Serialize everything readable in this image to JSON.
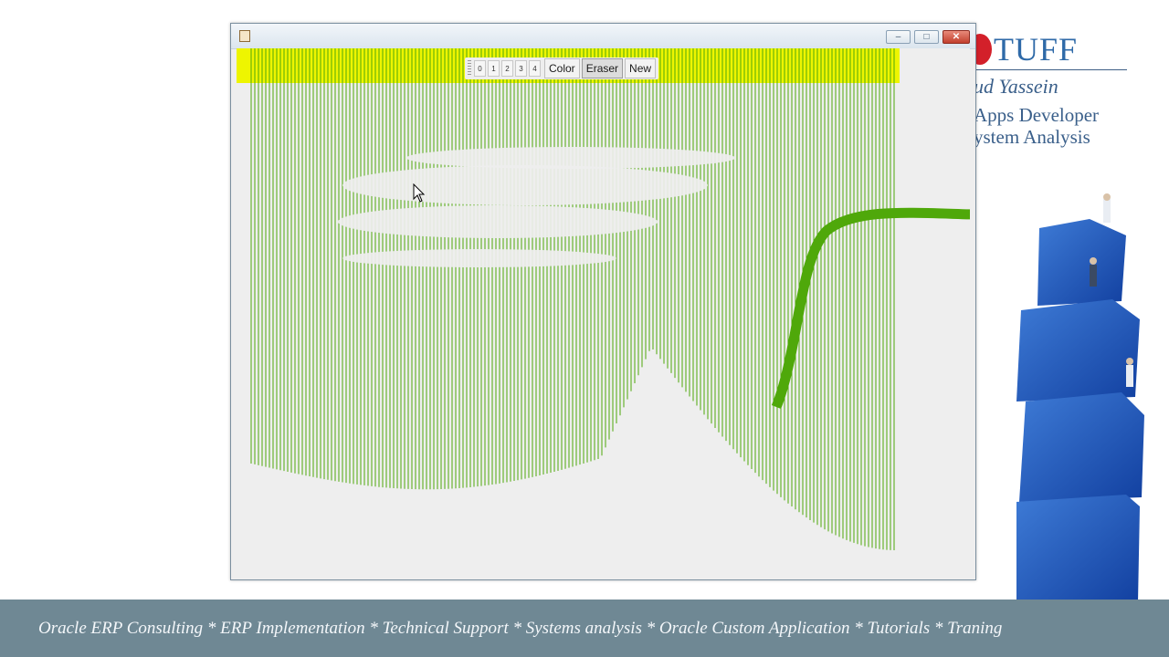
{
  "slide": {
    "brand_logo_text": "TUFF",
    "brand_name": "ud Yassein",
    "brand_role_line1": "Apps Developer",
    "brand_role_line2": "ystem Analysis",
    "footer_text": "Oracle ERP Consulting * ERP Implementation * Technical Support * Systems analysis * Oracle Custom Application * Tutorials  * Traning"
  },
  "window": {
    "minimize_icon": "minimize-icon",
    "maximize_icon": "maximize-icon",
    "close_icon": "close-icon",
    "minimize_glyph": "–",
    "maximize_glyph": "□",
    "close_glyph": "✕"
  },
  "toolbar": {
    "size_buttons": [
      "0",
      "1",
      "2",
      "3",
      "4"
    ],
    "color_label": "Color",
    "eraser_label": "Eraser",
    "new_label": "New"
  },
  "canvas": {
    "band_color": "#eef500",
    "stroke_color": "#4fa80a",
    "background_color": "#eeeeee"
  }
}
